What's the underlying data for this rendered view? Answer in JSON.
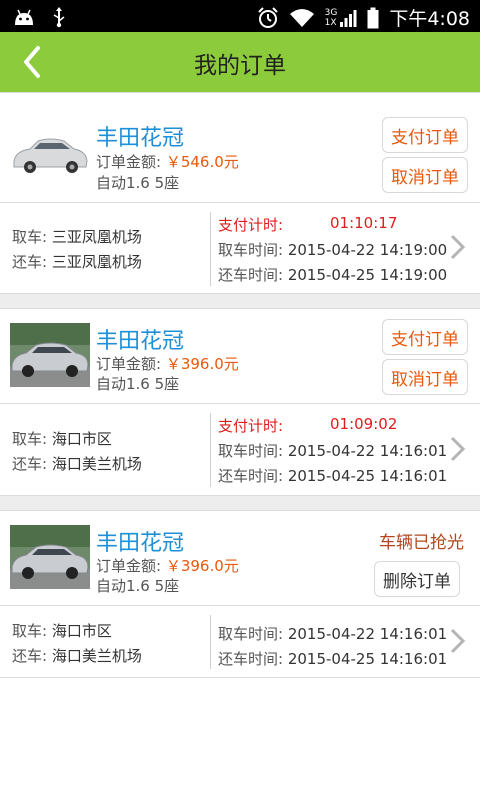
{
  "status_bar": {
    "time": "下午4:08",
    "network": "3G",
    "network2": "1X"
  },
  "header": {
    "title": "我的订单"
  },
  "orders": [
    {
      "car_name": "丰田花冠",
      "amount_label": "订单金额:",
      "amount": "￥546.0元",
      "spec": "自动1.6  5座",
      "btn_primary": "支付订单",
      "btn_secondary": "取消订单",
      "pickup_label": "取车:",
      "pickup_place": "三亚凤凰机场",
      "return_label": "还车:",
      "return_place": "三亚凤凰机场",
      "pay_timer_label": "支付计时:",
      "pay_timer": "01:10:17",
      "pickup_time_label": "取车时间:",
      "pickup_time": "2015-04-22 14:19:00",
      "return_time_label": "还车时间:",
      "return_time": "2015-04-25 14:19:00"
    },
    {
      "car_name": "丰田花冠",
      "amount_label": "订单金额:",
      "amount": "￥396.0元",
      "spec": "自动1.6  5座",
      "btn_primary": "支付订单",
      "btn_secondary": "取消订单",
      "pickup_label": "取车:",
      "pickup_place": "海口市区",
      "return_label": "还车:",
      "return_place": "海口美兰机场",
      "pay_timer_label": "支付计时:",
      "pay_timer": "01:09:02",
      "pickup_time_label": "取车时间:",
      "pickup_time": "2015-04-22 14:16:01",
      "return_time_label": "还车时间:",
      "return_time": "2015-04-25 14:16:01"
    },
    {
      "car_name": "丰田花冠",
      "amount_label": "订单金额:",
      "amount": "￥396.0元",
      "spec": "自动1.6  5座",
      "status": "车辆已抢光",
      "btn_delete": "删除订单",
      "pickup_label": "取车:",
      "pickup_place": "海口市区",
      "return_label": "还车:",
      "return_place": "海口美兰机场",
      "pickup_time_label": "取车时间:",
      "pickup_time": "2015-04-22 14:16:01",
      "return_time_label": "还车时间:",
      "return_time": "2015-04-25 14:16:01"
    }
  ],
  "colors": {
    "appbar": "#8ccc3c",
    "car_name": "#1f8fd6",
    "amount": "#e8590c",
    "timer": "#e11c1c",
    "status": "#b1471f"
  }
}
